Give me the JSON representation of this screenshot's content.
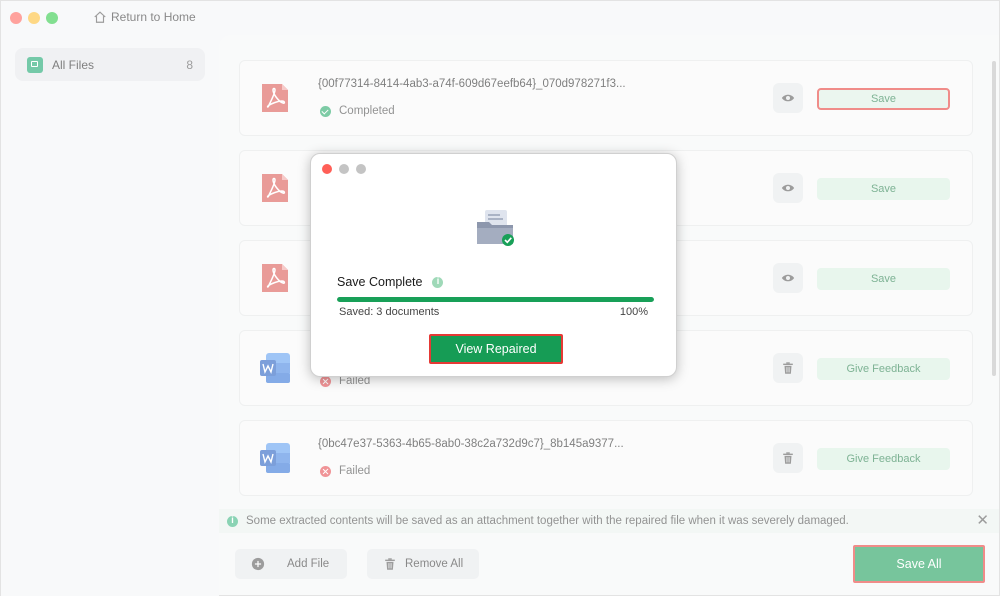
{
  "titlebar": {
    "home_label": "Return to Home"
  },
  "sidebar": {
    "items": [
      {
        "label": "All Files",
        "count": "8"
      }
    ]
  },
  "files": [
    {
      "name": "{00f77314-8414-4ab3-a74f-609d67eefb64}_070d978271f3...",
      "status": "Completed",
      "type": "pdf",
      "action": "Save",
      "icon": "eye-icon"
    },
    {
      "name": "",
      "status": "",
      "type": "pdf",
      "action": "Save",
      "icon": "eye-icon"
    },
    {
      "name": "",
      "status": "",
      "type": "pdf",
      "action": "Save",
      "icon": "eye-icon"
    },
    {
      "name": "",
      "status": "Failed",
      "type": "word",
      "action": "Give Feedback",
      "icon": "trash-icon"
    },
    {
      "name": "{0bc47e37-5363-4b65-8ab0-38c2a732d9c7}_8b145a9377...",
      "status": "Failed",
      "type": "word",
      "action": "Give Feedback",
      "icon": "trash-icon"
    }
  ],
  "infobar": {
    "text": "Some extracted contents will be saved as an attachment together with the repaired file when it was severely damaged."
  },
  "footer": {
    "add_file": "Add File",
    "remove_all": "Remove All",
    "save_all": "Save All"
  },
  "modal": {
    "title": "Save Complete",
    "saved_text": "Saved: 3 documents",
    "percent_text": "100%",
    "progress": 1.0,
    "button": "View Repaired"
  },
  "colors": {
    "accent": "#169c55",
    "highlight": "#e53935",
    "failed": "#e5484d",
    "pdf": "#d9534f",
    "word": "#2b6fd6"
  }
}
